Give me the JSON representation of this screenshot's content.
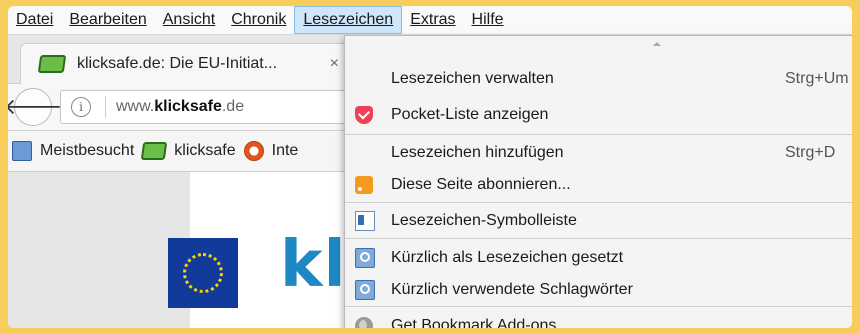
{
  "menubar": {
    "items": [
      {
        "label": "Datei"
      },
      {
        "label": "Bearbeiten"
      },
      {
        "label": "Ansicht"
      },
      {
        "label": "Chronik"
      },
      {
        "label": "Lesezeichen"
      },
      {
        "label": "Extras"
      },
      {
        "label": "Hilfe"
      }
    ],
    "active": "Lesezeichen"
  },
  "tab": {
    "title": "klicksafe.de: Die EU-Initiat...",
    "close_glyph": "×",
    "favicon_icon": "klicksafe-favicon-icon"
  },
  "navbar": {
    "back_glyph": "🡐",
    "info_glyph": "i",
    "url_prefix": "www.",
    "url_domain": "klicksafe",
    "url_suffix": ".de"
  },
  "bookmarks_toolbar": {
    "items": [
      {
        "label": "Meistbesucht",
        "icon": "smart-folder-icon"
      },
      {
        "label": "klicksafe",
        "icon": "klicksafe-favicon-icon"
      },
      {
        "label": "Inte",
        "icon": "lifebuoy-icon"
      }
    ]
  },
  "page": {
    "brand_text": "kli"
  },
  "dropdown": {
    "items": [
      {
        "label": "Lesezeichen verwalten",
        "shortcut": "Strg+Um",
        "icon": null
      },
      {
        "label": "Pocket-Liste anzeigen",
        "shortcut": "",
        "icon": "pocket-icon"
      },
      {
        "label": "Lesezeichen hinzufügen",
        "shortcut": "Strg+D",
        "icon": null
      },
      {
        "label": "Diese Seite abonnieren...",
        "shortcut": "",
        "icon": "rss-icon"
      },
      {
        "label": "Lesezeichen-Symbolleiste",
        "shortcut": "",
        "icon": "bookmarks-toolbar-icon"
      },
      {
        "label": "Kürzlich als Lesezeichen gesetzt",
        "shortcut": "",
        "icon": "smart-folder-icon"
      },
      {
        "label": "Kürzlich verwendete Schlagwörter",
        "shortcut": "",
        "icon": "smart-folder-icon"
      },
      {
        "label": "Get Bookmark Add-ons",
        "shortcut": "",
        "icon": "globe-icon"
      }
    ]
  },
  "colors": {
    "outer_frame": "#f7cd5c",
    "active_menu": "#cfe6fa",
    "pocket": "#ee4056",
    "rss": "#f39b1c",
    "brand": "#1e88c4",
    "eu_blue": "#123a9a"
  }
}
